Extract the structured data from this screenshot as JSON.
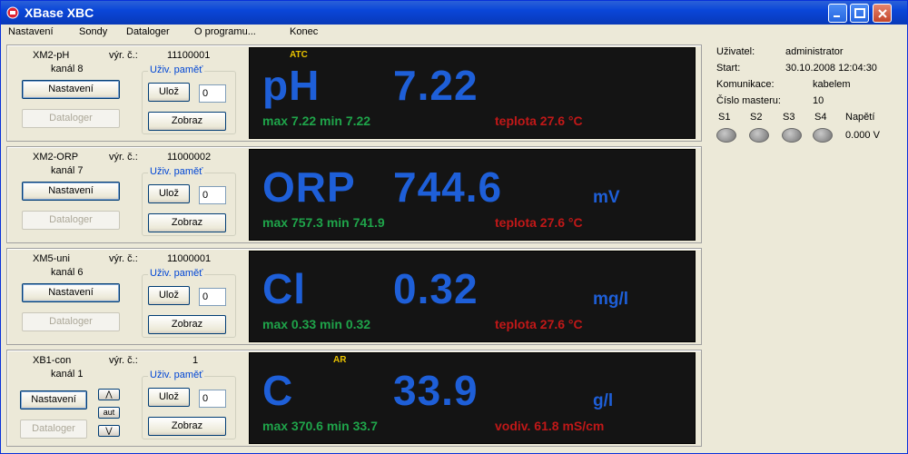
{
  "window": {
    "title": "XBase XBC"
  },
  "menu": [
    "Nastavení",
    "Sondy",
    "Dataloger",
    "O programu...",
    "Konec"
  ],
  "common": {
    "vyr_label": "výr. č.:",
    "settings_button": "Nastavení",
    "datalogger_button": "Dataloger",
    "memory_group": "Uživ. paměť",
    "save_button": "Ulož",
    "show_button": "Zobraz",
    "up_arrow": "⋀",
    "auto_button": "aut",
    "down_arrow": "⋁"
  },
  "panels": [
    {
      "name": "XM2-pH",
      "serial": "11100001",
      "channel": "kanál 8",
      "memory": "0",
      "tag": "ATC",
      "quantity": "pH",
      "value": "7.22",
      "unit": "",
      "minmax": "max 7.22  min 7.22",
      "secondary": "teplota   27.6 °C"
    },
    {
      "name": "XM2-ORP",
      "serial": "11000002",
      "channel": "kanál 7",
      "memory": "0",
      "tag": "",
      "quantity": "ORP",
      "value": "744.6",
      "unit": "mV",
      "minmax": "max 757.3  min 741.9",
      "secondary": "teplota   27.6 °C"
    },
    {
      "name": "XM5-uni",
      "serial": "11000001",
      "channel": "kanál 6",
      "memory": "0",
      "tag": "",
      "quantity": "Cl",
      "value": "0.32",
      "unit": "mg/l",
      "minmax": "max 0.33  min 0.32",
      "secondary": "teplota   27.6 °C"
    },
    {
      "name": "XB1-con",
      "serial": "1",
      "channel": "kanál 1",
      "memory": "0",
      "tag": "AR",
      "quantity": "C",
      "value": "33.9",
      "unit": "g/l",
      "minmax": "max 370.6  min 33.7",
      "secondary": "vodiv. 61.8 mS/cm"
    }
  ],
  "info": {
    "user_label": "Uživatel:",
    "user_value": "administrator",
    "start_label": "Start:",
    "start_value": "30.10.2008 12:04:30",
    "comm_label": "Komunikace:",
    "comm_value": "kabelem",
    "master_label": "Číslo masteru:",
    "master_value": "10",
    "sensors": [
      "S1",
      "S2",
      "S3",
      "S4"
    ],
    "voltage_label": "Napětí",
    "voltage_value": "0.000 V"
  },
  "colors": {
    "display_bg": "#141414",
    "main_value": "#1e5fd8",
    "minmax": "#1fa44a",
    "secondary": "#c01818",
    "tag": "#e8c200"
  }
}
